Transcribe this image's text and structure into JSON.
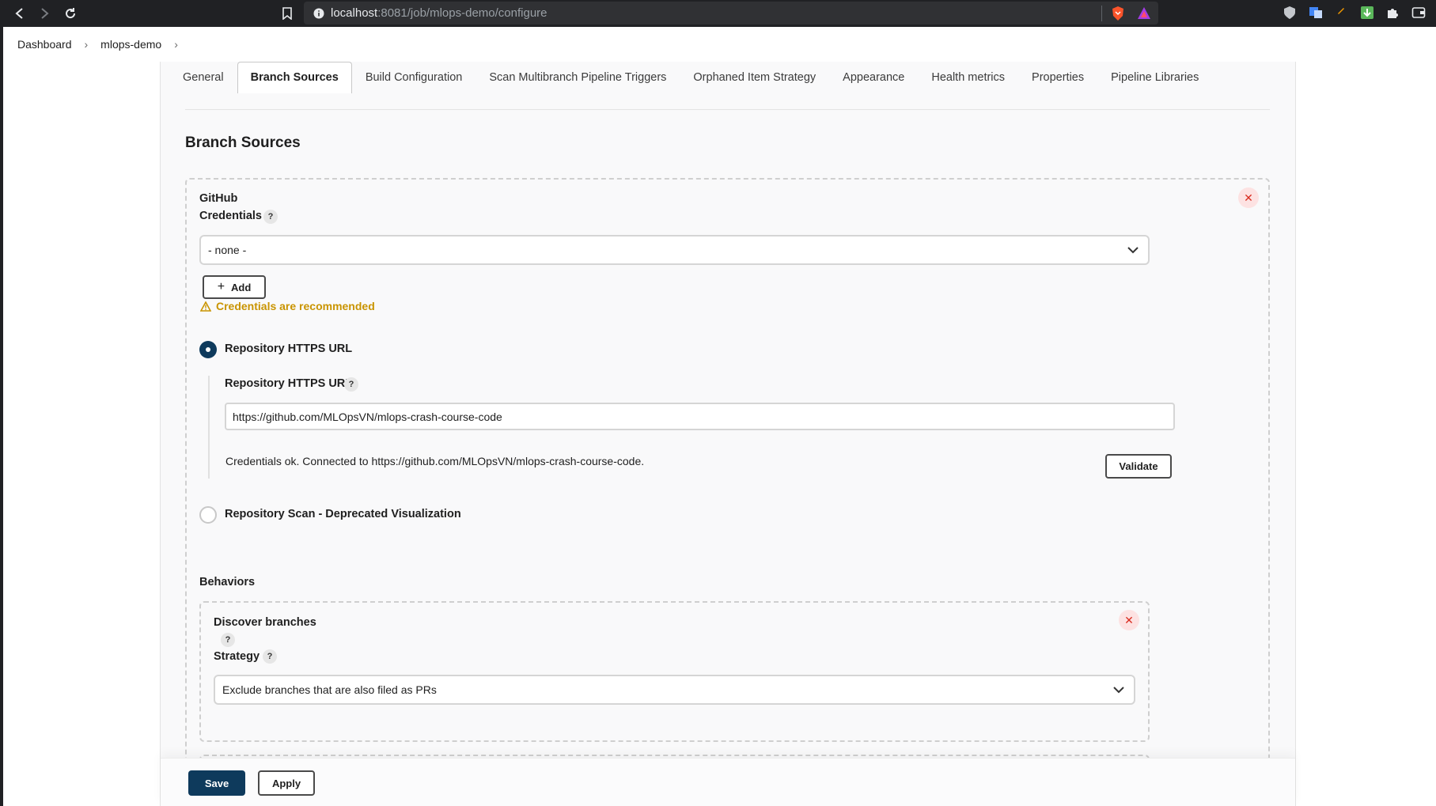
{
  "browser": {
    "url_host": "localhost",
    "url_path": ":8081/job/mlops-demo/configure"
  },
  "breadcrumb": {
    "items": [
      "Dashboard",
      "mlops-demo"
    ]
  },
  "tabs": [
    {
      "label": "General",
      "active": false
    },
    {
      "label": "Branch Sources",
      "active": true
    },
    {
      "label": "Build Configuration",
      "active": false
    },
    {
      "label": "Scan Multibranch Pipeline Triggers",
      "active": false
    },
    {
      "label": "Orphaned Item Strategy",
      "active": false
    },
    {
      "label": "Appearance",
      "active": false
    },
    {
      "label": "Health metrics",
      "active": false
    },
    {
      "label": "Properties",
      "active": false
    },
    {
      "label": "Pipeline Libraries",
      "active": false
    }
  ],
  "section": {
    "title": "Branch Sources"
  },
  "github": {
    "title": "GitHub",
    "credentials_label": "Credentials",
    "credentials_value": "- none -",
    "add_label": "Add",
    "warning": "Credentials are recommended",
    "radio_https_label": "Repository HTTPS URL",
    "url_field_label": "Repository HTTPS URL",
    "url_value": "https://github.com/MLOpsVN/mlops-crash-course-code",
    "status": "Credentials ok. Connected to https://github.com/MLOpsVN/mlops-crash-course-code.",
    "validate_label": "Validate",
    "radio_scan_label": "Repository Scan - Deprecated Visualization"
  },
  "behaviors": {
    "label": "Behaviors",
    "discover_title": "Discover branches",
    "strategy_label": "Strategy",
    "strategy_value": "Exclude branches that are also filed as PRs"
  },
  "footer": {
    "save_label": "Save",
    "apply_label": "Apply"
  },
  "colors": {
    "primary": "#0e3a5c",
    "warning": "#c99400",
    "danger": "#d92d20"
  }
}
